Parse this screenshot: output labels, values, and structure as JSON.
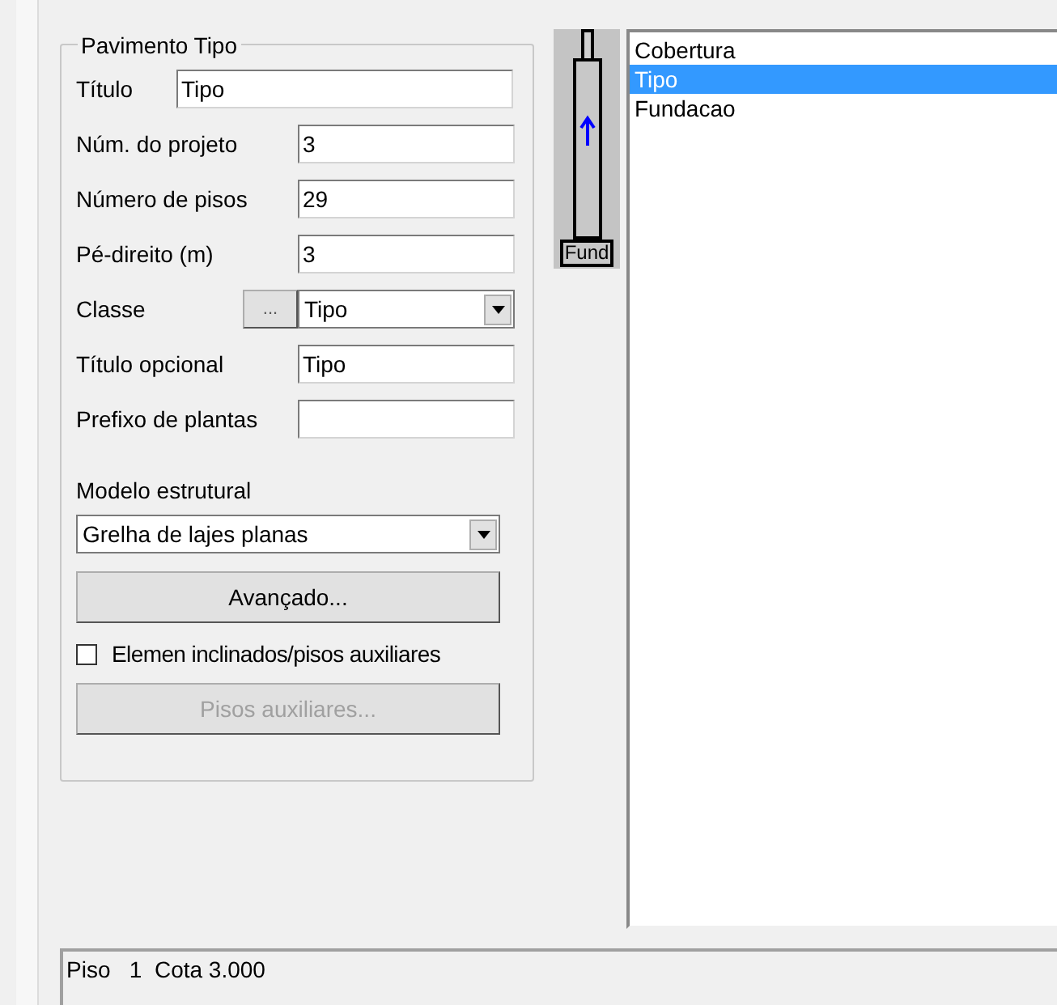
{
  "group": {
    "title": "Pavimento Tipo",
    "fields": [
      {
        "kind": "text",
        "label": "Título",
        "value": "Tipo",
        "wide": true
      },
      {
        "kind": "text",
        "label": "Núm. do projeto",
        "value": "3"
      },
      {
        "kind": "text",
        "label": "Número de pisos",
        "value": "29"
      },
      {
        "kind": "text",
        "label": "Pé-direito (m)",
        "value": "3"
      },
      {
        "kind": "combo",
        "label": "Classe",
        "button": "...",
        "value": "Tipo"
      },
      {
        "kind": "text",
        "label": "Título opcional",
        "value": "Tipo"
      },
      {
        "kind": "text",
        "label": "Prefixo de plantas"
      }
    ],
    "model": {
      "label": "Modelo estrutural",
      "value": "Grelha de lajes planas"
    },
    "advanced_button": {
      "label": "Avançado...",
      "disabled": false
    },
    "checkbox": {
      "label": "Elemen inclinados/pisos auxiliares",
      "checked": false
    },
    "aux_button": {
      "label": "Pisos auxiliares...",
      "disabled": true
    }
  },
  "building": {
    "label": "Fund"
  },
  "floors": [
    {
      "label": "Cobertura",
      "selected": false
    },
    {
      "label": "Tipo",
      "selected": true
    },
    {
      "label": "Fundacao",
      "selected": false
    }
  ],
  "status_bar": {
    "text": "Piso   1  Cota 3.000"
  }
}
